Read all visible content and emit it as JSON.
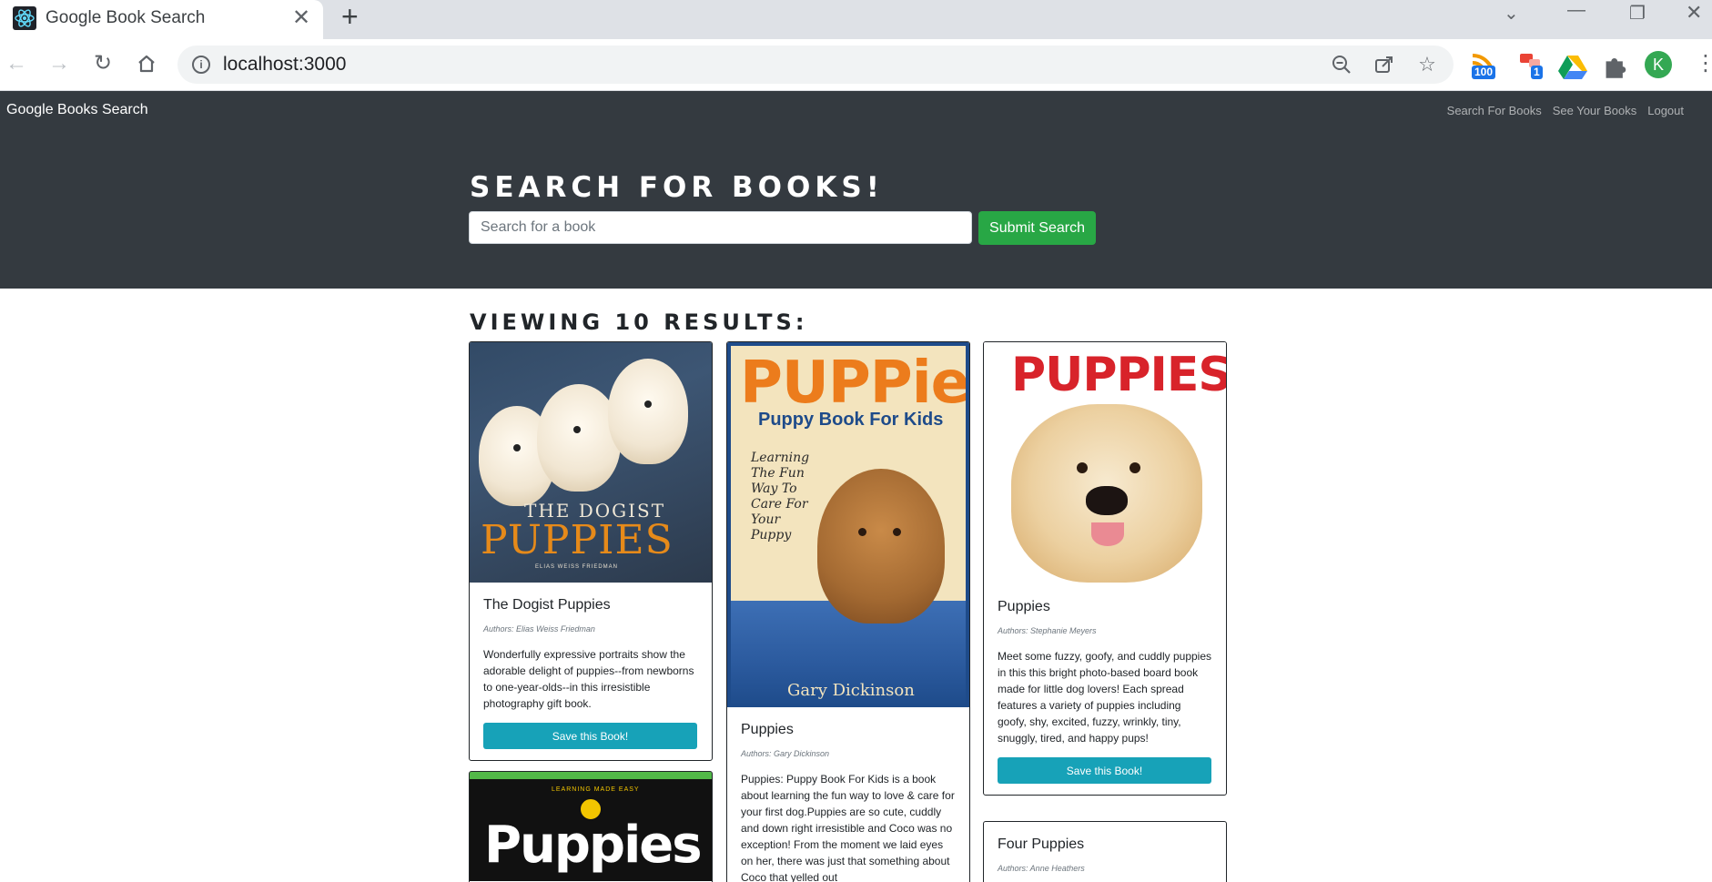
{
  "browser": {
    "tab_title": "Google Book Search",
    "tab_close": "✕",
    "new_tab": "+",
    "url": "localhost:3000",
    "extensions": [
      {
        "name": "rss-extension",
        "badge": "100"
      },
      {
        "name": "ext-with-badge",
        "badge": "1"
      },
      {
        "name": "drive-extension",
        "badge": ""
      },
      {
        "name": "extensions-puzzle",
        "badge": ""
      }
    ],
    "profile_initial": "K"
  },
  "app": {
    "brand": "Google Books Search",
    "nav_links": [
      "Search For Books",
      "See Your Books",
      "Logout"
    ],
    "hero_title": "SEARCH FOR BOOKS!",
    "search_placeholder": "Search for a book",
    "submit_label": "Submit Search",
    "results_title": "VIEWING 10 RESULTS:"
  },
  "books": [
    {
      "title": "The Dogist Puppies",
      "authors": "Authors: Elias Weiss Friedman",
      "description": "Wonderfully expressive portraits show the adorable delight of puppies--from newborns to one-year-olds--in this irresistible photography gift book.",
      "save_label": "Save this Book!",
      "cover_text": [
        "THE DOGIST",
        "PUPPIES",
        "ELIAS WEISS FRIEDMAN"
      ]
    },
    {
      "title": "Puppies",
      "authors": "Authors: Gary Dickinson",
      "description": "Puppies: Puppy Book For Kids is a book about learning the fun way to love & care for your first dog.Puppies are so cute, cuddly and down right irresistible and Coco was no exception! From the moment we laid eyes on her, there was just that something about Coco that yelled out",
      "cover_text": [
        "PUPPies",
        "Puppy Book For Kids",
        "Learning The Fun Way To Care For Your Puppy",
        "Gary Dickinson"
      ]
    },
    {
      "title": "Puppies",
      "authors": "Authors: Stephanie Meyers",
      "description": "Meet some fuzzy, goofy, and cuddly puppies in this this bright photo-based board book made for little dog lovers! Each spread features a variety of puppies including goofy, shy, excited, fuzzy, wrinkly, tiny, snuggly, tired, and happy pups!",
      "save_label": "Save this Book!",
      "cover_text": [
        "PUPPIES"
      ]
    },
    {
      "title": "",
      "cover_text": [
        "LEARNING MADE EASY",
        "Puppies"
      ]
    },
    {
      "title": "Four Puppies",
      "authors": "Authors: Anne Heathers"
    }
  ],
  "colors": {
    "navbar": "#343a40",
    "submit": "#28a745",
    "save": "#17a2b8"
  }
}
